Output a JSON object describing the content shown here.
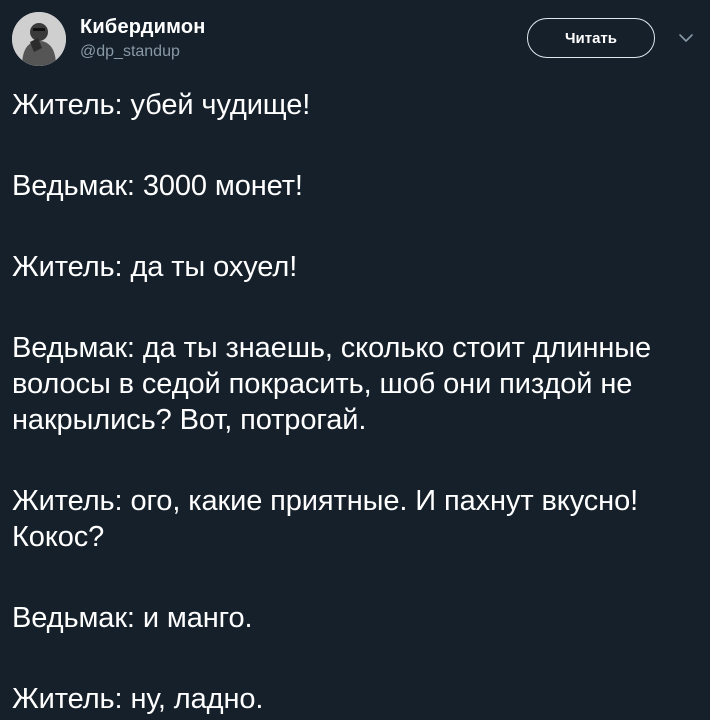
{
  "author": {
    "display_name": "Кибердимон",
    "handle": "@dp_standup",
    "avatar_icon": "user-avatar"
  },
  "actions": {
    "follow_label": "Читать",
    "more_icon": "chevron-down-icon"
  },
  "tweet": {
    "paragraphs": [
      "Житель: убей чудище!",
      "Ведьмак: 3000 монет!",
      "Житель: да ты охуел!",
      "Ведьмак: да ты знаешь, сколько стоит длинные волосы в седой покрасить, шоб они пиздой не накрылись? Вот, потрогай.",
      "Житель: ого, какие приятные. И пахнут вкусно! Кокос?",
      "Ведьмак: и манго.",
      "Житель: ну, ладно."
    ]
  },
  "colors": {
    "background": "#15202b",
    "text": "#ffffff",
    "secondary": "#8899a6",
    "button_border": "#e1e8ed"
  }
}
